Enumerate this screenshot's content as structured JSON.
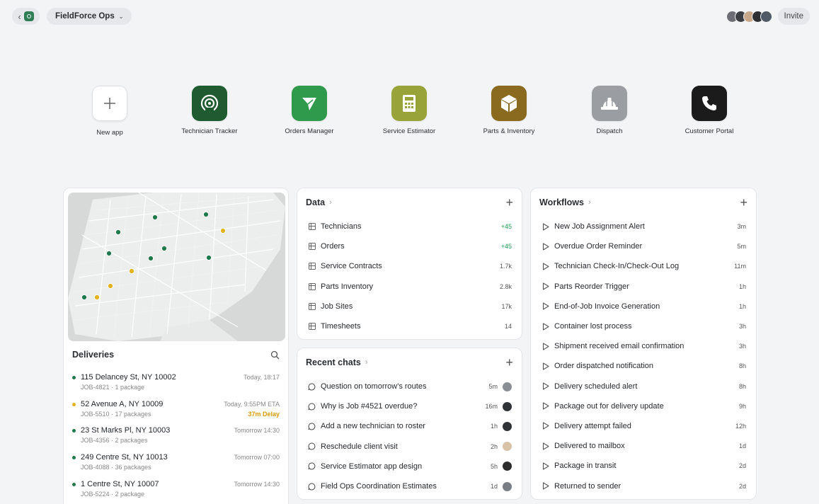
{
  "workspace": {
    "name": "FieldForce Ops"
  },
  "header": {
    "invite_label": "Invite"
  },
  "apps": [
    {
      "label": "New app",
      "icon": "plus-icon",
      "color": "#ffffff"
    },
    {
      "label": "Technician Tracker",
      "icon": "radar-icon",
      "color": "#1f5a30"
    },
    {
      "label": "Orders Manager",
      "icon": "paper-plane-icon",
      "color": "#2f9a4c"
    },
    {
      "label": "Service Estimator",
      "icon": "calculator-icon",
      "color": "#98a33a"
    },
    {
      "label": "Parts & Inventory",
      "icon": "box-icon",
      "color": "#8a6a1e"
    },
    {
      "label": "Dispatch",
      "icon": "hard-hat-icon",
      "color": "#9a9da2"
    },
    {
      "label": "Customer Portal",
      "icon": "phone-icon",
      "color": "#1b1b1b"
    }
  ],
  "data_card": {
    "title": "Data",
    "items": [
      {
        "label": "Technicians",
        "value": "+45"
      },
      {
        "label": "Orders",
        "value": "+45"
      },
      {
        "label": "Service Contracts",
        "value": "1.7k"
      },
      {
        "label": "Parts Inventory",
        "value": "2.8k"
      },
      {
        "label": "Job Sites",
        "value": "17k"
      },
      {
        "label": "Timesheets",
        "value": "14"
      }
    ]
  },
  "chats_card": {
    "title": "Recent chats",
    "items": [
      {
        "label": "Question on tomorrow's routes",
        "time": "5m"
      },
      {
        "label": "Why is Job #4521 overdue?",
        "time": "16m"
      },
      {
        "label": "Add a new technician to roster",
        "time": "1h"
      },
      {
        "label": "Reschedule client visit",
        "time": "2h"
      },
      {
        "label": "Service Estimator app design",
        "time": "5h"
      },
      {
        "label": "Field Ops Coordination Estimates",
        "time": "1d"
      }
    ]
  },
  "workflows_card": {
    "title": "Workflows",
    "items": [
      {
        "label": "New Job Assignment Alert",
        "time": "3m"
      },
      {
        "label": "Overdue Order Reminder",
        "time": "5m"
      },
      {
        "label": "Technician Check-In/Check-Out Log",
        "time": "11m"
      },
      {
        "label": "Parts Reorder Trigger",
        "time": "1h"
      },
      {
        "label": "End-of-Job Invoice Generation",
        "time": "1h"
      },
      {
        "label": "Container lost process",
        "time": "3h"
      },
      {
        "label": "Shipment received email confirmation",
        "time": "3h"
      },
      {
        "label": "Order dispatched notification",
        "time": "8h"
      },
      {
        "label": "Delivery scheduled alert",
        "time": "8h"
      },
      {
        "label": "Package out for delivery update",
        "time": "9h"
      },
      {
        "label": "Delivery attempt failed",
        "time": "12h"
      },
      {
        "label": "Delivered to mailbox",
        "time": "1d"
      },
      {
        "label": "Package in transit",
        "time": "2d"
      },
      {
        "label": "Returned to sender",
        "time": "2d"
      }
    ]
  },
  "deliveries": {
    "title": "Deliveries",
    "items": [
      {
        "address": "115 Delancey St, NY 10002",
        "time": "Today, 18:17",
        "meta": "JOB-4821 · 1 package",
        "status": "on-time",
        "delay": ""
      },
      {
        "address": "52 Avenue A, NY 10009",
        "time": "Today, 9:55PM ETA",
        "meta": "JOB-5510 · 17 packages",
        "status": "delayed",
        "delay": "37m Delay"
      },
      {
        "address": "23 St Marks Pl, NY 10003",
        "time": "Tomorrow 14:30",
        "meta": "JOB-4356 · 2 packages",
        "status": "on-time",
        "delay": ""
      },
      {
        "address": "249 Centre St, NY 10013",
        "time": "Tomorrow 07:00",
        "meta": "JOB-4088 · 36 packages",
        "status": "on-time",
        "delay": ""
      },
      {
        "address": "1 Centre St, NY 10007",
        "time": "Tomorrow 14:30",
        "meta": "JOB-5224 · 2 package",
        "status": "on-time",
        "delay": ""
      }
    ]
  },
  "colors": {
    "on_time": "#1e7a4c",
    "delayed": "#e3b21c",
    "accent_green": "#1f9d55"
  }
}
